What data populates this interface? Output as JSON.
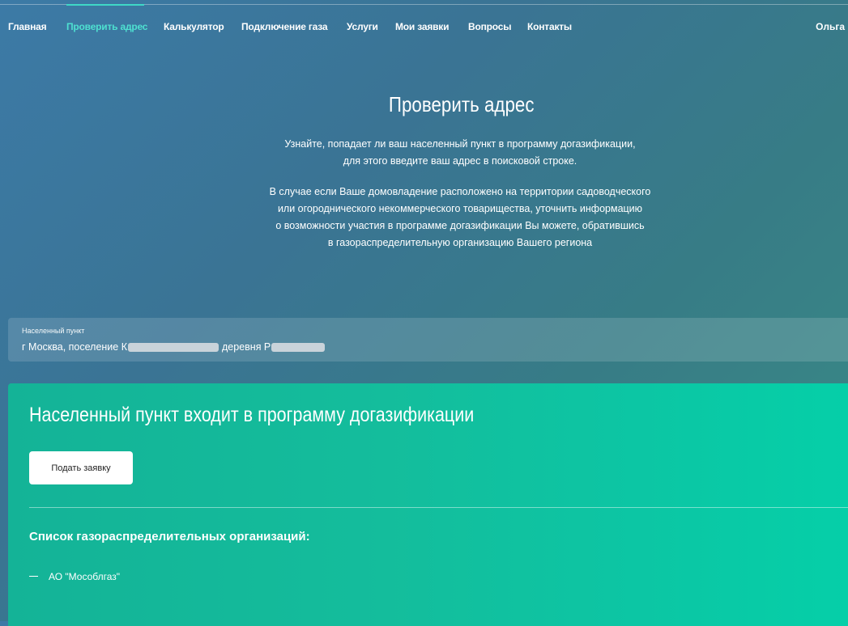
{
  "nav": {
    "items": [
      {
        "label": "Главная",
        "active": false
      },
      {
        "label": "Проверить адрес",
        "active": true
      },
      {
        "label": "Калькулятор",
        "active": false
      },
      {
        "label": "Подключение газа",
        "active": false
      },
      {
        "label": "Услуги",
        "active": false
      },
      {
        "label": "Мои заявки",
        "active": false
      },
      {
        "label": "Вопросы",
        "active": false
      },
      {
        "label": "Контакты",
        "active": false
      }
    ],
    "user": "Ольга"
  },
  "hero": {
    "title": "Проверить адрес",
    "paragraph1_line1": "Узнайте, попадает ли ваш населенный пункт в программу догазификации,",
    "paragraph1_line2": "для этого введите ваш адрес в поисковой строке.",
    "paragraph2_line1": "В случае если Ваше домовладение расположено на территории садоводческого",
    "paragraph2_line2": "или огороднического некоммерческого товарищества, уточнить информацию",
    "paragraph2_line3": "о возможности участия в программе догазификации Вы можете, обратившись",
    "paragraph2_line4": "в газораспределительную организацию Вашего региона"
  },
  "search": {
    "label": "Населенный пункт",
    "value_part1": "г Москва, поселение К",
    "value_part2": "деревня Р"
  },
  "result": {
    "title": "Населенный пункт входит в программу догазификации",
    "apply_label": "Подать заявку",
    "orgs_title": "Список газораспределительных организаций:",
    "orgs": [
      "АО \"Мособлгаз\""
    ]
  },
  "colors": {
    "accent": "#4ee0d0",
    "card_green": "#14bd9c",
    "background_blue": "#3a7494"
  }
}
